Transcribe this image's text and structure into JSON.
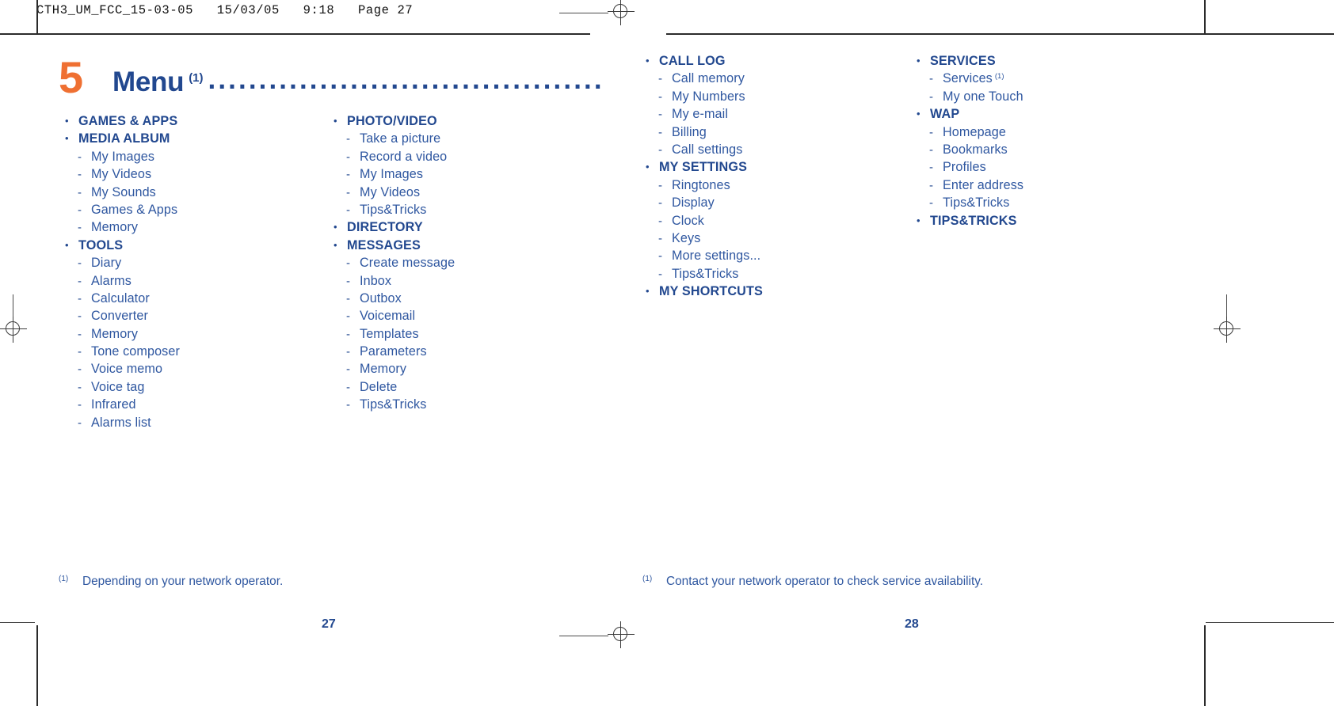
{
  "proof": {
    "header": "CTH3_UM_FCC_15-03-05   15/03/05   9:18   Page 27"
  },
  "title": {
    "number": "5",
    "word": "Menu",
    "superscript": "(1)",
    "dots": "........................................................"
  },
  "columns": [
    {
      "id": "column-1",
      "entries": [
        {
          "level": 1,
          "marker": "•",
          "label": "GAMES & APPS"
        },
        {
          "level": 1,
          "marker": "•",
          "label": "MEDIA ALBUM"
        },
        {
          "level": 2,
          "marker": "-",
          "label": "My Images"
        },
        {
          "level": 2,
          "marker": "-",
          "label": "My Videos"
        },
        {
          "level": 2,
          "marker": "-",
          "label": "My Sounds"
        },
        {
          "level": 2,
          "marker": "-",
          "label": "Games & Apps"
        },
        {
          "level": 2,
          "marker": "-",
          "label": "Memory"
        },
        {
          "level": 1,
          "marker": "•",
          "label": "TOOLS"
        },
        {
          "level": 2,
          "marker": "-",
          "label": "Diary"
        },
        {
          "level": 2,
          "marker": "-",
          "label": "Alarms"
        },
        {
          "level": 2,
          "marker": "-",
          "label": "Calculator"
        },
        {
          "level": 2,
          "marker": "-",
          "label": "Converter"
        },
        {
          "level": 2,
          "marker": "-",
          "label": "Memory"
        },
        {
          "level": 2,
          "marker": "-",
          "label": "Tone composer"
        },
        {
          "level": 2,
          "marker": "-",
          "label": "Voice memo"
        },
        {
          "level": 2,
          "marker": "-",
          "label": "Voice tag"
        },
        {
          "level": 2,
          "marker": "-",
          "label": "Infrared"
        },
        {
          "level": 2,
          "marker": "-",
          "label": "Alarms list"
        }
      ]
    },
    {
      "id": "column-2",
      "entries": [
        {
          "level": 1,
          "marker": "•",
          "label": "PHOTO/VIDEO"
        },
        {
          "level": 2,
          "marker": "-",
          "label": "Take a picture"
        },
        {
          "level": 2,
          "marker": "-",
          "label": "Record a video"
        },
        {
          "level": 2,
          "marker": "-",
          "label": "My Images"
        },
        {
          "level": 2,
          "marker": "-",
          "label": "My Videos"
        },
        {
          "level": 2,
          "marker": "-",
          "label": "Tips&Tricks"
        },
        {
          "level": 1,
          "marker": "•",
          "label": "DIRECTORY"
        },
        {
          "level": 1,
          "marker": "•",
          "label": "MESSAGES"
        },
        {
          "level": 2,
          "marker": "-",
          "label": "Create message"
        },
        {
          "level": 2,
          "marker": "-",
          "label": "Inbox"
        },
        {
          "level": 2,
          "marker": "-",
          "label": "Outbox"
        },
        {
          "level": 2,
          "marker": "-",
          "label": "Voicemail"
        },
        {
          "level": 2,
          "marker": "-",
          "label": "Templates"
        },
        {
          "level": 2,
          "marker": "-",
          "label": "Parameters"
        },
        {
          "level": 2,
          "marker": "-",
          "label": "Memory"
        },
        {
          "level": 2,
          "marker": "-",
          "label": "Delete"
        },
        {
          "level": 2,
          "marker": "-",
          "label": "Tips&Tricks"
        }
      ]
    },
    {
      "id": "column-3",
      "entries": [
        {
          "level": 1,
          "marker": "•",
          "label": "CALL LOG"
        },
        {
          "level": 2,
          "marker": "-",
          "label": "Call memory"
        },
        {
          "level": 2,
          "marker": "-",
          "label": "My Numbers"
        },
        {
          "level": 2,
          "marker": "-",
          "label": "My e-mail"
        },
        {
          "level": 2,
          "marker": "-",
          "label": "Billing"
        },
        {
          "level": 2,
          "marker": "-",
          "label": "Call settings"
        },
        {
          "level": 1,
          "marker": "•",
          "label": "MY SETTINGS"
        },
        {
          "level": 2,
          "marker": "-",
          "label": "Ringtones"
        },
        {
          "level": 2,
          "marker": "-",
          "label": "Display"
        },
        {
          "level": 2,
          "marker": "-",
          "label": "Clock"
        },
        {
          "level": 2,
          "marker": "-",
          "label": "Keys"
        },
        {
          "level": 2,
          "marker": "-",
          "label": "More settings..."
        },
        {
          "level": 2,
          "marker": "-",
          "label": "Tips&Tricks"
        },
        {
          "level": 1,
          "marker": "•",
          "label": "MY SHORTCUTS"
        }
      ]
    },
    {
      "id": "column-4",
      "entries": [
        {
          "level": 1,
          "marker": "•",
          "label": "SERVICES"
        },
        {
          "level": 2,
          "marker": "-",
          "label": "Services",
          "note": "(1)"
        },
        {
          "level": 2,
          "marker": "-",
          "label": "My one Touch"
        },
        {
          "level": 1,
          "marker": "•",
          "label": "WAP"
        },
        {
          "level": 2,
          "marker": "-",
          "label": "Homepage"
        },
        {
          "level": 2,
          "marker": "-",
          "label": "Bookmarks"
        },
        {
          "level": 2,
          "marker": "-",
          "label": "Profiles"
        },
        {
          "level": 2,
          "marker": "-",
          "label": "Enter address"
        },
        {
          "level": 2,
          "marker": "-",
          "label": "Tips&Tricks"
        },
        {
          "level": 1,
          "marker": "•",
          "label": "TIPS&TRICKS"
        }
      ]
    }
  ],
  "footnotes": [
    {
      "mark": "(1)",
      "text": "Depending on your network operator."
    },
    {
      "mark": "(1)",
      "text": "Contact your network operator to check service availability."
    }
  ],
  "folios": {
    "left": "27",
    "right": "28"
  },
  "colors": {
    "chapter_orange": "#ef7032",
    "heading_blue": "#22488f",
    "body_blue": "#2f57a0"
  }
}
